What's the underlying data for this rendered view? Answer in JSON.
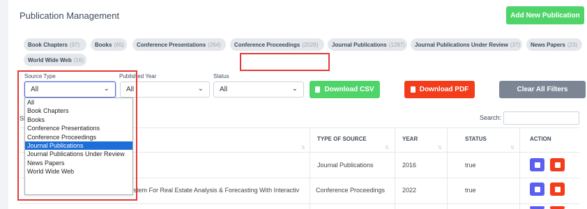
{
  "page_title": "Publication Management",
  "add_button": "Add New Publication",
  "chips": [
    {
      "label": "Book Chapters",
      "count": "(97)"
    },
    {
      "label": "Books",
      "count": "(65)"
    },
    {
      "label": "Conference Presentations",
      "count": "(264)"
    },
    {
      "label": "Conference Proceedings",
      "count": "(2028)"
    },
    {
      "label": "Journal Publications",
      "count": "(1287)"
    },
    {
      "label": "Journal Publications Under Review",
      "count": "(37)"
    },
    {
      "label": "News Papers",
      "count": "(23)"
    },
    {
      "label": "World Wide Web",
      "count": "(16)"
    }
  ],
  "filters": {
    "source_type": {
      "label": "Source Type",
      "value": "All"
    },
    "published_year": {
      "label": "Published Year",
      "value": "All"
    },
    "status": {
      "label": "Status",
      "value": "All"
    }
  },
  "buttons": {
    "download_csv": "Download CSV",
    "download_pdf": "Download PDF",
    "clear_filters": "Clear All Filters"
  },
  "search_label": "Search:",
  "show_prefix": "Sh",
  "columns": {
    "type": "TYPE OF SOURCE",
    "year": "YEAR",
    "status": "STATUS",
    "action": "ACTION"
  },
  "rows": [
    {
      "title": "",
      "type": "Journal Publications",
      "year": "2016",
      "status": "true"
    },
    {
      "title": "ystem For Real Estate Analysis & Forecasting With Interactiv",
      "type": "Conference Proceedings",
      "year": "2022",
      "status": "true"
    }
  ],
  "dropdown_options": [
    "All",
    "Book Chapters",
    "Books",
    "Conference Presentations",
    "Conference Proceedings",
    "Journal Publications",
    "Journal Publications Under Review",
    "News Papers",
    "World Wide Web"
  ],
  "selected_option": "Journal Publications",
  "colors": {
    "green": "#4fd46a",
    "red": "#f23c1a",
    "gray": "#7b8593",
    "blue": "#5b5ff0",
    "select_blue": "#1d6ed8",
    "highlight_red": "#e53935"
  }
}
